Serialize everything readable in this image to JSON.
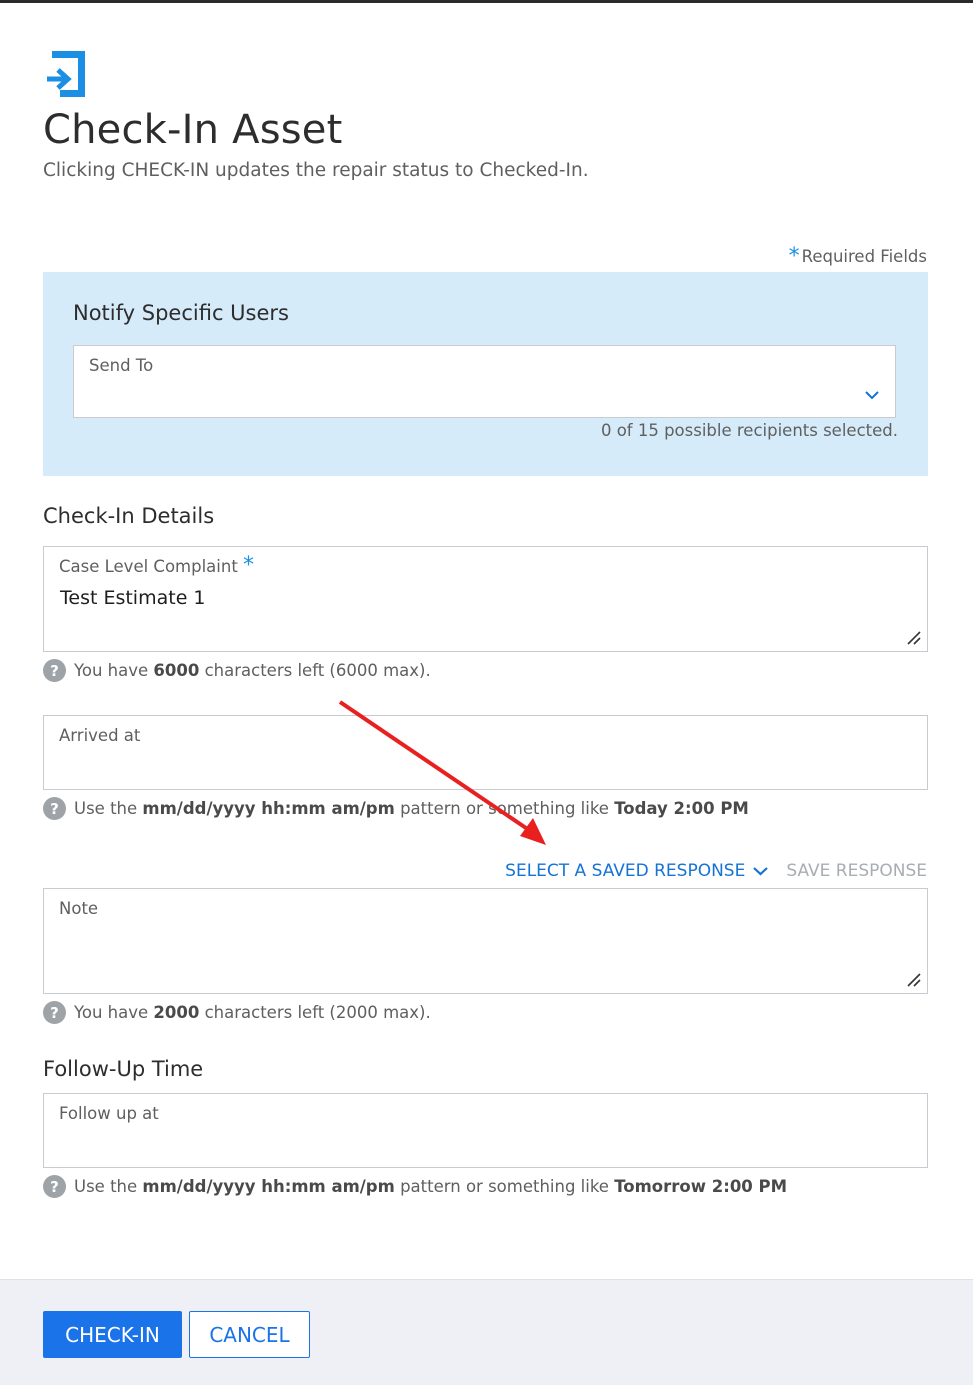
{
  "dialog": {
    "title": "Check-In Asset",
    "subtitle": "Clicking CHECK-IN updates the repair status to Checked-In.",
    "required_label": "Required Fields"
  },
  "notify": {
    "title": "Notify Specific Users",
    "send_to_label": "Send To",
    "send_to_value": "",
    "recipients_status": "0 of 15 possible recipients selected."
  },
  "check_in_details": {
    "title": "Check-In Details",
    "complaint": {
      "label": "Case Level Complaint",
      "value": "Test Estimate 1",
      "hint_prefix": "You have",
      "hint_count": "6000",
      "hint_suffix": "characters left (6000 max)."
    },
    "arrived": {
      "label": "Arrived at",
      "value": "",
      "hint_prefix": "Use the",
      "hint_pattern": "mm/dd/yyyy hh:mm am/pm",
      "hint_middle": "pattern or something like",
      "hint_example": "Today 2:00 PM"
    },
    "saved_response": {
      "select_label": "SELECT A SAVED RESPONSE",
      "save_label": "SAVE RESPONSE"
    },
    "note": {
      "label": "Note",
      "value": "",
      "hint_prefix": "You have",
      "hint_count": "2000",
      "hint_suffix": "characters left (2000 max)."
    }
  },
  "follow_up": {
    "title": "Follow-Up Time",
    "label": "Follow up at",
    "value": "",
    "hint_prefix": "Use the",
    "hint_pattern": "mm/dd/yyyy hh:mm am/pm",
    "hint_middle": "pattern or something like",
    "hint_example": "Tomorrow 2:00 PM"
  },
  "footer": {
    "primary_label": "CHECK-IN",
    "secondary_label": "CANCEL"
  },
  "icons": {
    "header": "check-in-arrow-icon",
    "required": "asterisk-icon",
    "dropdown": "chevron-down-icon",
    "hint": "question-circle-icon",
    "resize": "resize-handle-icon"
  },
  "colors": {
    "accent": "#1a73e8",
    "notify_bg": "#d6ebfa",
    "annotation_arrow": "#e8201f",
    "footer_bg": "#eff0f5"
  }
}
